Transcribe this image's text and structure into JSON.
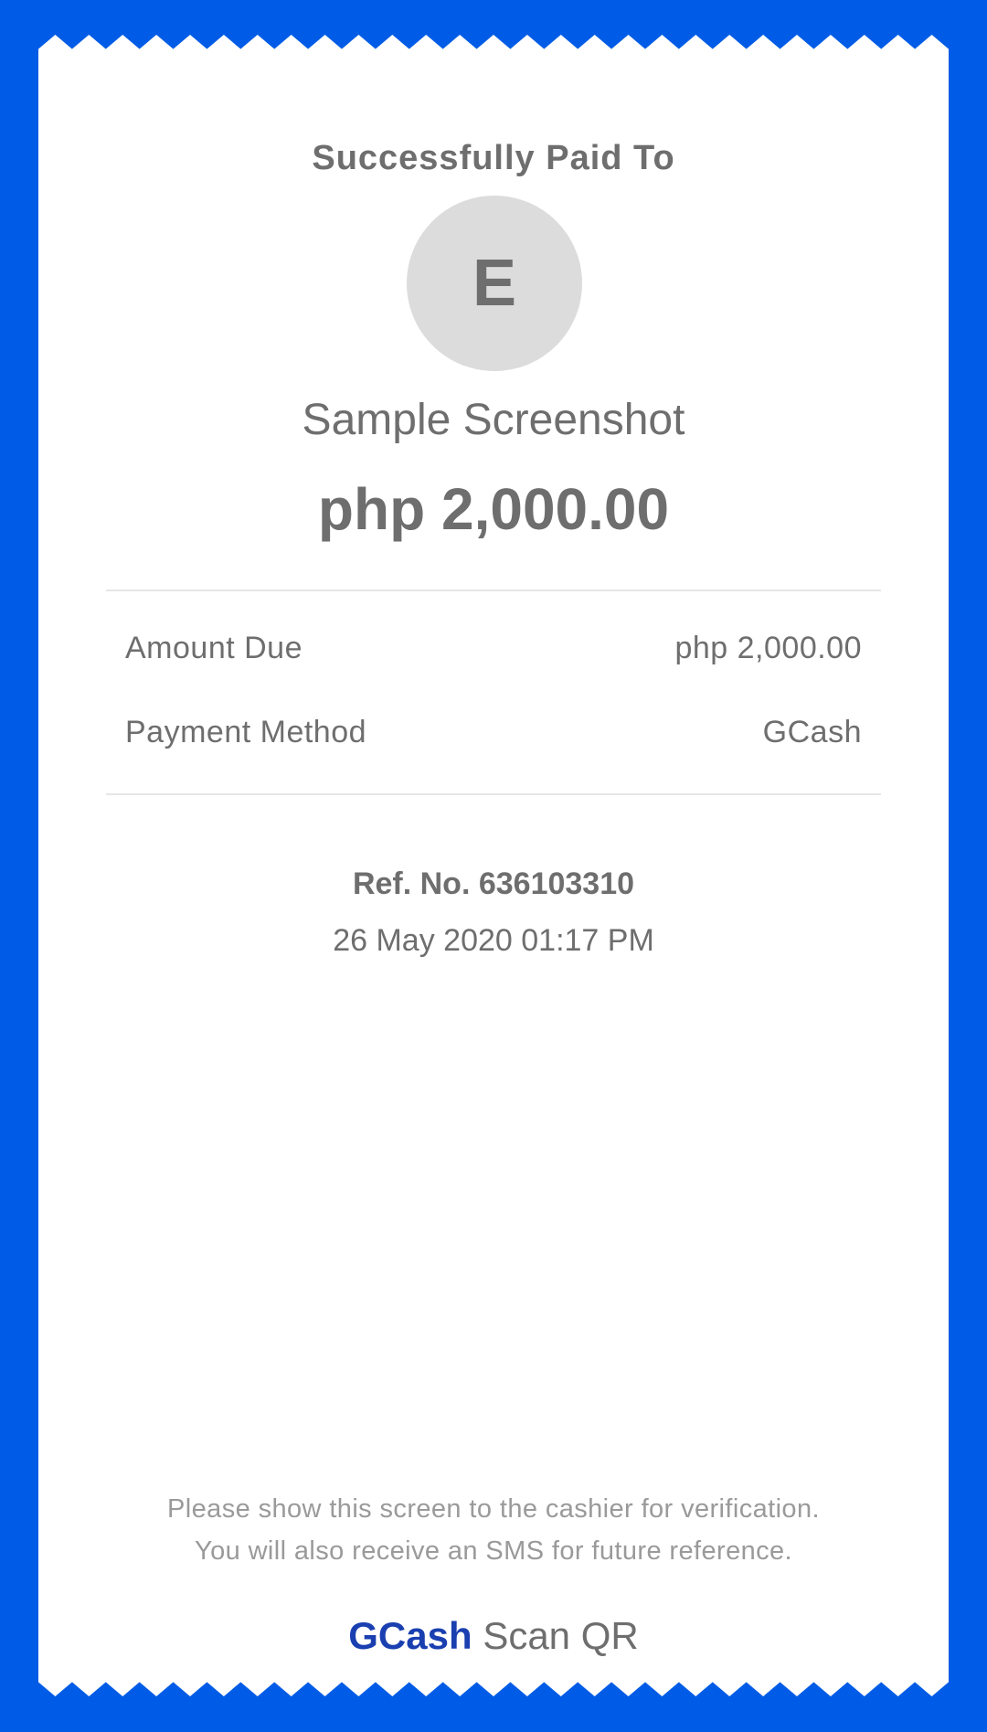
{
  "receipt": {
    "title": "Successfully Paid To",
    "avatar_initial": "E",
    "merchant_name": "Sample Screenshot",
    "amount": "php 2,000.00"
  },
  "details": [
    {
      "label": "Amount Due",
      "value": "php 2,000.00"
    },
    {
      "label": "Payment Method",
      "value": "GCash"
    }
  ],
  "reference": {
    "ref_no": "Ref. No. 636103310",
    "date": "26 May 2020 01:17 PM"
  },
  "footer": {
    "note_line1": "Please show this screen to the cashier for verification.",
    "note_line2": "You will also receive an SMS for future reference.",
    "brand_name": "GCash",
    "brand_suffix": "Scan QR"
  },
  "colors": {
    "background": "#005ce6",
    "brand": "#1a3fb0",
    "text": "#6e6e6e",
    "muted": "#9a9a9a"
  }
}
